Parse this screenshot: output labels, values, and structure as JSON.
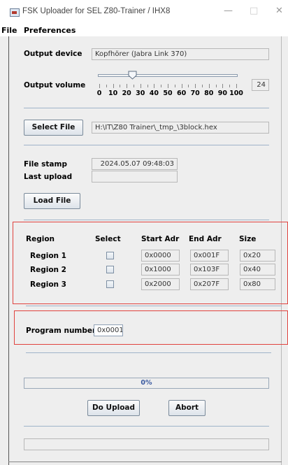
{
  "window": {
    "title": "FSK Uploader for SEL Z80-Trainer / IHX8",
    "min_glyph": "—",
    "max_glyph": "□",
    "close_glyph": "✕"
  },
  "menu": {
    "items": [
      "File",
      "Preferences"
    ]
  },
  "output": {
    "device_label": "Output device",
    "device_value": "Kopfhörer (Jabra Link 370)",
    "volume_label": "Output volume",
    "volume_value": "24",
    "volume_fraction": 0.24,
    "ticks": [
      "0",
      "10",
      "20",
      "30",
      "40",
      "50",
      "60",
      "70",
      "80",
      "90",
      "100"
    ]
  },
  "file": {
    "select_button": "Select File",
    "path": "H:\\IT\\Z80 Trainer\\_tmp_\\3block.hex",
    "stamp_label": "File stamp",
    "stamp_value": "2024.05.07 09:48:03",
    "last_upload_label": "Last upload",
    "last_upload_value": "",
    "load_button": "Load File"
  },
  "regions": {
    "headers": {
      "region": "Region",
      "select": "Select",
      "start": "Start Adr",
      "end": "End Adr",
      "size": "Size"
    },
    "rows": [
      {
        "name": "Region 1",
        "start": "0x0000",
        "end": "0x001F",
        "size": "0x20"
      },
      {
        "name": "Region 2",
        "start": "0x1000",
        "end": "0x103F",
        "size": "0x40"
      },
      {
        "name": "Region 3",
        "start": "0x2000",
        "end": "0x207F",
        "size": "0x80"
      }
    ]
  },
  "program": {
    "label": "Program number",
    "value": "0x0001"
  },
  "upload": {
    "progress_text": "0%",
    "progress_fraction": 0,
    "upload_button": "Do Upload",
    "abort_button": "Abort",
    "status": ""
  },
  "colors": {
    "highlight_border": "#e0423e",
    "separator": "#9fb3c9",
    "progress_text": "#3a5aa0"
  }
}
